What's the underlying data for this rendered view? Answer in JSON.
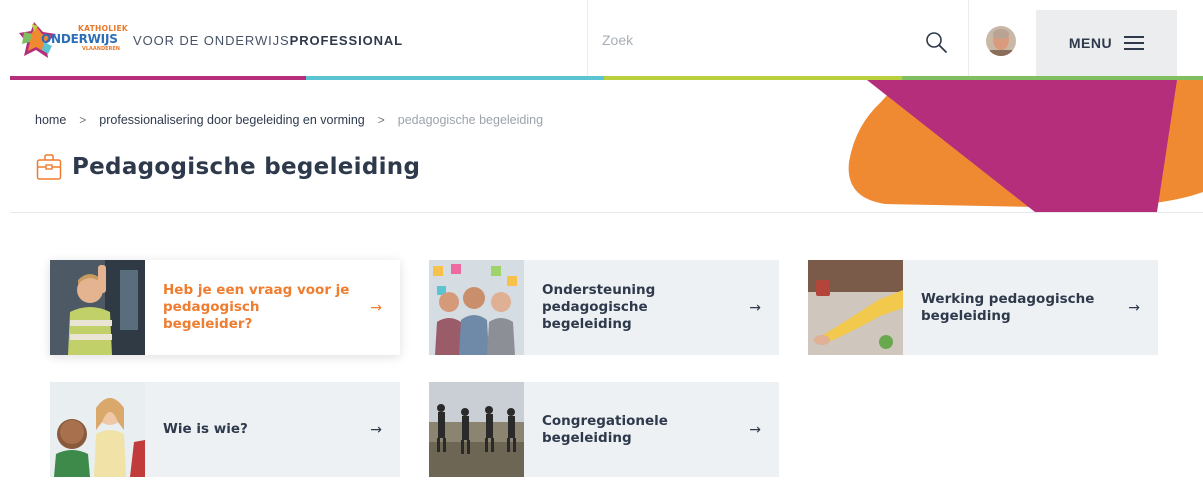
{
  "header": {
    "logo": {
      "line1": "KATHOLIEK",
      "line2": "ONDERWIJS",
      "line3": "VLAANDEREN",
      "alt": "Katholiek Onderwijs Vlaanderen"
    },
    "tagline_prefix": "VOOR DE ONDERWIJS",
    "tagline_bold": "PROFESSIONAL",
    "search": {
      "placeholder": "Zoek",
      "value": ""
    },
    "menu_label": "MENU"
  },
  "brand_colors": {
    "magenta": "#b52e7c",
    "cyan": "#5bc4d2",
    "lime": "#b9cf3b",
    "green": "#7fbf62",
    "orange": "#ef8a32",
    "text": "#2e3a4c"
  },
  "breadcrumb": [
    {
      "label": "home"
    },
    {
      "label": "professionalisering door begeleiding en vorming"
    },
    {
      "label": "pedagogische begeleiding",
      "current": true
    }
  ],
  "breadcrumb_separator": ">",
  "page": {
    "title": "Pedagogische begeleiding",
    "icon": "briefcase-icon"
  },
  "tiles": [
    {
      "label": "Heb je een vraag voor je pedagogisch begeleider?",
      "arrow": "→",
      "image": "child-classroom-photo",
      "active": true
    },
    {
      "label": "Ondersteuning pedagogische begeleiding",
      "arrow": "→",
      "image": "team-sticky-notes-photo"
    },
    {
      "label": "Werking pedagogische begeleiding",
      "arrow": "→",
      "image": "hands-table-photo"
    },
    {
      "label": "Wie is wie?",
      "arrow": "→",
      "image": "children-smiling-photo"
    },
    {
      "label": "Congregationele begeleiding",
      "arrow": "→",
      "image": "people-walking-photo"
    }
  ]
}
